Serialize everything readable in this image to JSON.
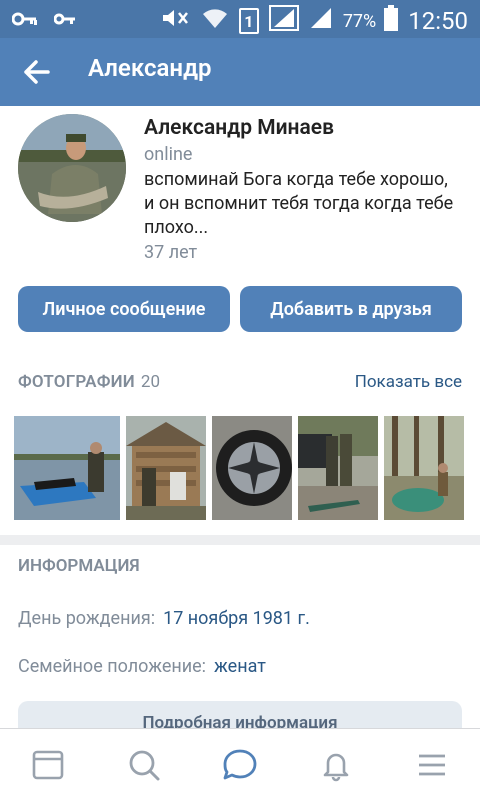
{
  "status_bar": {
    "battery_percent": "77%",
    "time": "12:50",
    "sim_label": "1"
  },
  "app_bar": {
    "title": "Александр"
  },
  "profile": {
    "name": "Александр Минаев",
    "online": "online",
    "status_text": "вспоминай Бога когда тебе хорошо, и он вспомнит тебя тогда когда тебе плохо...",
    "age": "37 лет"
  },
  "actions": {
    "message_label": "Личное сообщение",
    "add_friend_label": "Добавить в друзья"
  },
  "photos": {
    "label": "ФОТОГРАФИИ",
    "count": "20",
    "show_all": "Показать все"
  },
  "info": {
    "title": "ИНФОРМАЦИЯ",
    "birthday_label": "День рождения:",
    "birthday_value": "17 ноября 1981 г.",
    "family_label": "Семейное положение:",
    "family_value": "женат",
    "details_button": "Подробная информация"
  },
  "colors": {
    "accent": "#5181b8",
    "status_bar": "#4a76a8",
    "link": "#2a5885",
    "muted": "#818c99"
  },
  "tabbar_icons": [
    "news-icon",
    "search-icon",
    "messages-icon",
    "notifications-icon",
    "menu-icon"
  ]
}
